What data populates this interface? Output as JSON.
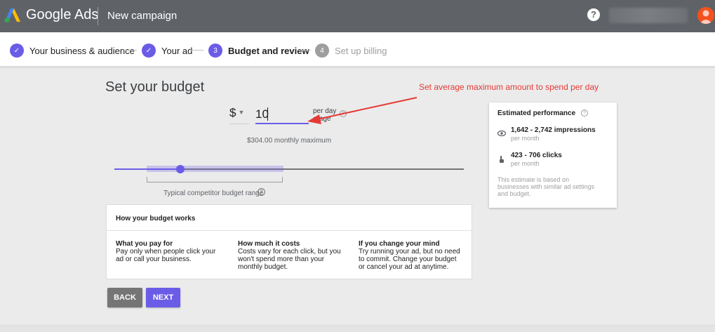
{
  "header": {
    "brand": "Google Ads",
    "page_name": "New campaign",
    "help": "?"
  },
  "stepper": {
    "steps": [
      {
        "number": "✓",
        "label": "Your business & audience",
        "state": "done"
      },
      {
        "number": "✓",
        "label": "Your ad",
        "state": "done"
      },
      {
        "number": "3",
        "label": "Budget and review",
        "state": "active"
      },
      {
        "number": "4",
        "label": "Set up billing",
        "state": "pending"
      }
    ]
  },
  "budget": {
    "title": "Set your budget",
    "currency": "$",
    "amount": "10",
    "per_day_line1": "per day",
    "per_day_line2": "erage",
    "monthly_max": "$304.00 monthly maximum",
    "slider_value_fraction": 0.19,
    "range_label": "Typical competitor budget range"
  },
  "works": {
    "title": "How your budget works",
    "columns": [
      {
        "heading": "What you pay for",
        "lines": [
          "Pay only when people click your",
          "ad or call your business."
        ]
      },
      {
        "heading": "How much it costs",
        "lines": [
          "Costs vary for each click, but you",
          "won't spend more than your",
          "monthly budget."
        ]
      },
      {
        "heading": "If you change your mind",
        "lines": [
          "Try running your ad, but no need",
          "to commit. Change your budget",
          "or cancel your ad at anytime."
        ]
      }
    ]
  },
  "buttons": {
    "back": "BACK",
    "next": "NEXT"
  },
  "performance": {
    "title": "Estimated performance",
    "impressions": {
      "value": "1,642 - 2,742 impressions",
      "sub": "per month",
      "icon": "eye-icon"
    },
    "clicks": {
      "value": "423 - 706 clicks",
      "sub": "per month",
      "icon": "pointer-icon"
    },
    "note_lines": [
      "This estimate is based on",
      "businesses with similar ad settings",
      "and budget."
    ]
  },
  "annotation": {
    "text": "Set average maximum amount to spend per day",
    "color": "#e53935"
  },
  "colors": {
    "accent": "#6b5ce7",
    "topbar": "#5f6368",
    "avatar": "#f4511e"
  }
}
